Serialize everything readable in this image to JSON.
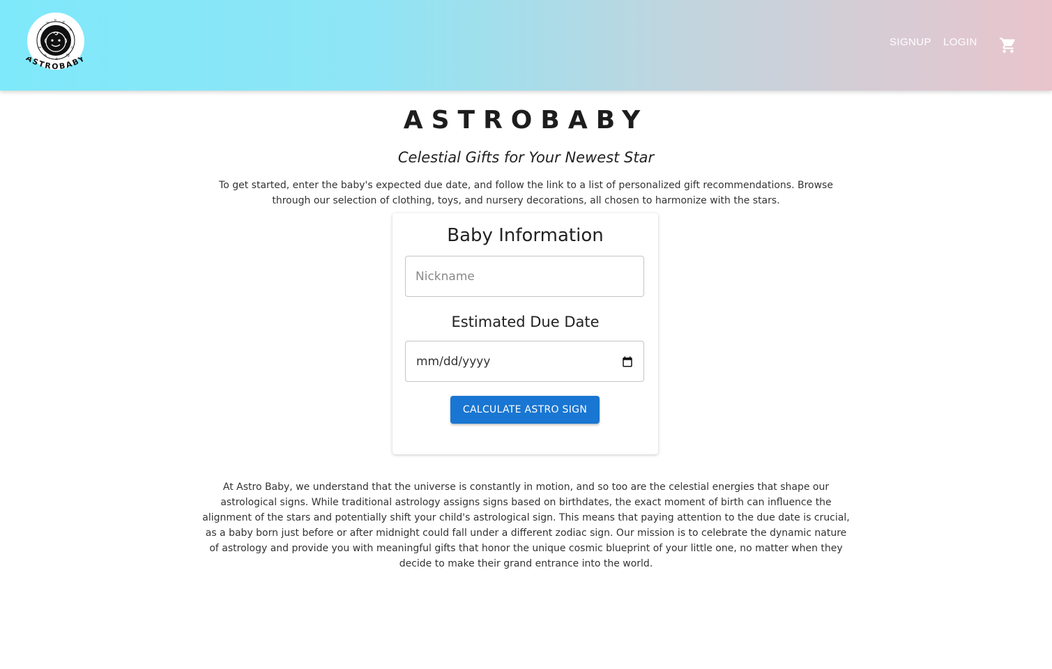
{
  "header": {
    "logo_text": "ASTROBABY",
    "nav": {
      "signup": "SIGNUP",
      "login": "LOGIN"
    },
    "cart_icon": "shopping-cart-icon",
    "gradient_colors": [
      "#7ee9fb",
      "#c1d5de",
      "#e9c4cc"
    ]
  },
  "hero": {
    "title": "ASTROBABY",
    "tagline": "Celestial Gifts for Your Newest Star",
    "intro": "To get started, enter the baby's expected due date, and follow the link to a list of personalized gift recommendations. Browse through our selection of clothing, toys, and nursery decorations, all chosen to harmonize with the stars."
  },
  "form": {
    "title": "Baby Information",
    "nickname_placeholder": "Nickname",
    "nickname_value": "",
    "due_date_label": "Estimated Due Date",
    "due_date_value": "mm/dd/yyyy",
    "calendar_icon": "calendar-icon",
    "submit_label": "CALCULATE ASTRO SIGN",
    "accent_color": "#1976d2"
  },
  "about": {
    "text": "At Astro Baby, we understand that the universe is constantly in motion, and so too are the celestial energies that shape our astrological signs. While traditional astrology assigns signs based on birthdates, the exact moment of birth can influence the alignment of the stars and potentially shift your child's astrological sign. This means that paying attention to the due date is crucial, as a baby born just before or after midnight could fall under a different zodiac sign. Our mission is to celebrate the dynamic nature of astrology and provide you with meaningful gifts that honor the unique cosmic blueprint of your little one, no matter when they decide to make their grand entrance into the world."
  }
}
